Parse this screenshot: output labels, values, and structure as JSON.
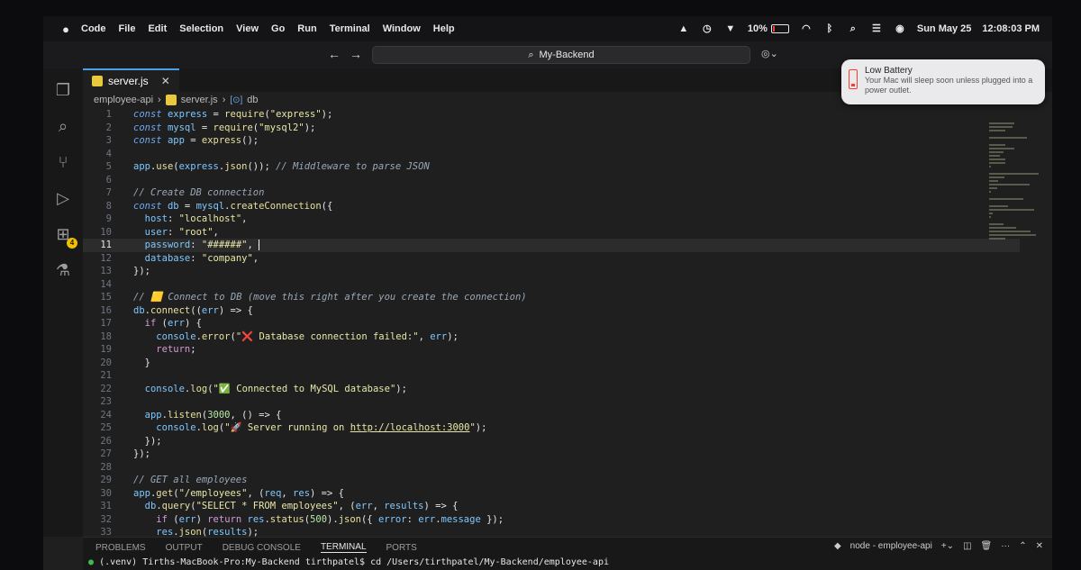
{
  "menubar": {
    "app_name": "Code",
    "menus": [
      "File",
      "Edit",
      "Selection",
      "View",
      "Go",
      "Run",
      "Terminal",
      "Window",
      "Help"
    ],
    "battery_percent": "10%",
    "battery_level": 0.1,
    "date": "Sun May 25",
    "time": "12:08:03 PM"
  },
  "titlebar": {
    "search_text": "My-Backend"
  },
  "activitybar": {
    "extensions_badge": "4"
  },
  "tab": {
    "filename": "server.js",
    "close": "✕"
  },
  "breadcrumb": {
    "folder": "employee-api",
    "file": "server.js",
    "symbol": "db"
  },
  "notification": {
    "title": "Low Battery",
    "body": "Your Mac will sleep soon unless plugged into a power outlet."
  },
  "editor": {
    "current_line": 11,
    "lines": [
      [
        [
          "kw",
          "const "
        ],
        [
          "var",
          "express"
        ],
        [
          "op",
          " = "
        ],
        [
          "fn",
          "require"
        ],
        [
          "op",
          "("
        ],
        [
          "str",
          "\"express\""
        ],
        [
          "op",
          ");"
        ]
      ],
      [
        [
          "kw",
          "const "
        ],
        [
          "var",
          "mysql"
        ],
        [
          "op",
          " = "
        ],
        [
          "fn",
          "require"
        ],
        [
          "op",
          "("
        ],
        [
          "str",
          "\"mysql2\""
        ],
        [
          "op",
          ");"
        ]
      ],
      [
        [
          "kw",
          "const "
        ],
        [
          "var",
          "app"
        ],
        [
          "op",
          " = "
        ],
        [
          "fn",
          "express"
        ],
        [
          "op",
          "();"
        ]
      ],
      [],
      [
        [
          "var",
          "app"
        ],
        [
          "op",
          "."
        ],
        [
          "fn",
          "use"
        ],
        [
          "op",
          "("
        ],
        [
          "var",
          "express"
        ],
        [
          "op",
          "."
        ],
        [
          "fn",
          "json"
        ],
        [
          "op",
          "()); "
        ],
        [
          "cm",
          "// Middleware to parse JSON"
        ]
      ],
      [],
      [
        [
          "cm",
          "// Create DB connection"
        ]
      ],
      [
        [
          "kw",
          "const "
        ],
        [
          "var",
          "db"
        ],
        [
          "op",
          " = "
        ],
        [
          "var",
          "mysql"
        ],
        [
          "op",
          "."
        ],
        [
          "fn",
          "createConnection"
        ],
        [
          "op",
          "({"
        ]
      ],
      [
        [
          "op",
          "  "
        ],
        [
          "var",
          "host"
        ],
        [
          "op",
          ": "
        ],
        [
          "str",
          "\"localhost\""
        ],
        [
          "op",
          ","
        ]
      ],
      [
        [
          "op",
          "  "
        ],
        [
          "var",
          "user"
        ],
        [
          "op",
          ": "
        ],
        [
          "str",
          "\"root\""
        ],
        [
          "op",
          ","
        ]
      ],
      [
        [
          "op",
          "  "
        ],
        [
          "var",
          "password"
        ],
        [
          "op",
          ": "
        ],
        [
          "str",
          "\"######\""
        ],
        [
          "op",
          ", "
        ]
      ],
      [
        [
          "op",
          "  "
        ],
        [
          "var",
          "database"
        ],
        [
          "op",
          ": "
        ],
        [
          "str",
          "\"company\""
        ],
        [
          "op",
          ","
        ]
      ],
      [
        [
          "op",
          "});"
        ]
      ],
      [],
      [
        [
          "cm",
          "// 🟨 Connect to DB (move this right after you create the connection)"
        ]
      ],
      [
        [
          "var",
          "db"
        ],
        [
          "op",
          "."
        ],
        [
          "fn",
          "connect"
        ],
        [
          "op",
          "(("
        ],
        [
          "var",
          "err"
        ],
        [
          "op",
          ") => {"
        ]
      ],
      [
        [
          "op",
          "  "
        ],
        [
          "ctl",
          "if"
        ],
        [
          "op",
          " ("
        ],
        [
          "var",
          "err"
        ],
        [
          "op",
          ") {"
        ]
      ],
      [
        [
          "op",
          "    "
        ],
        [
          "var",
          "console"
        ],
        [
          "op",
          "."
        ],
        [
          "fn",
          "error"
        ],
        [
          "op",
          "("
        ],
        [
          "str",
          "\"❌ Database connection failed:\""
        ],
        [
          "op",
          ", "
        ],
        [
          "var",
          "err"
        ],
        [
          "op",
          ");"
        ]
      ],
      [
        [
          "op",
          "    "
        ],
        [
          "ctl",
          "return"
        ],
        [
          "op",
          ";"
        ]
      ],
      [
        [
          "op",
          "  }"
        ]
      ],
      [],
      [
        [
          "op",
          "  "
        ],
        [
          "var",
          "console"
        ],
        [
          "op",
          "."
        ],
        [
          "fn",
          "log"
        ],
        [
          "op",
          "("
        ],
        [
          "str",
          "\"✅ Connected to MySQL database\""
        ],
        [
          "op",
          ");"
        ]
      ],
      [],
      [
        [
          "op",
          "  "
        ],
        [
          "var",
          "app"
        ],
        [
          "op",
          "."
        ],
        [
          "fn",
          "listen"
        ],
        [
          "op",
          "("
        ],
        [
          "num",
          "3000"
        ],
        [
          "op",
          ", () => {"
        ]
      ],
      [
        [
          "op",
          "    "
        ],
        [
          "var",
          "console"
        ],
        [
          "op",
          "."
        ],
        [
          "fn",
          "log"
        ],
        [
          "op",
          "("
        ],
        [
          "str",
          "\"🚀 Server running on "
        ],
        [
          "link",
          "http://localhost:3000"
        ],
        [
          "str",
          "\""
        ],
        [
          "op",
          ");"
        ]
      ],
      [
        [
          "op",
          "  });"
        ]
      ],
      [
        [
          "op",
          "});"
        ]
      ],
      [],
      [
        [
          "cm",
          "// GET all employees"
        ]
      ],
      [
        [
          "var",
          "app"
        ],
        [
          "op",
          "."
        ],
        [
          "fn",
          "get"
        ],
        [
          "op",
          "("
        ],
        [
          "str",
          "\"/employees\""
        ],
        [
          "op",
          ", ("
        ],
        [
          "var",
          "req"
        ],
        [
          "op",
          ", "
        ],
        [
          "var",
          "res"
        ],
        [
          "op",
          ") => {"
        ]
      ],
      [
        [
          "op",
          "  "
        ],
        [
          "var",
          "db"
        ],
        [
          "op",
          "."
        ],
        [
          "fn",
          "query"
        ],
        [
          "op",
          "("
        ],
        [
          "str",
          "\"SELECT * FROM employees\""
        ],
        [
          "op",
          ", ("
        ],
        [
          "var",
          "err"
        ],
        [
          "op",
          ", "
        ],
        [
          "var",
          "results"
        ],
        [
          "op",
          ") => {"
        ]
      ],
      [
        [
          "op",
          "    "
        ],
        [
          "ctl",
          "if"
        ],
        [
          "op",
          " ("
        ],
        [
          "var",
          "err"
        ],
        [
          "op",
          ") "
        ],
        [
          "ctl",
          "return "
        ],
        [
          "var",
          "res"
        ],
        [
          "op",
          "."
        ],
        [
          "fn",
          "status"
        ],
        [
          "op",
          "("
        ],
        [
          "num",
          "500"
        ],
        [
          "op",
          ")."
        ],
        [
          "fn",
          "json"
        ],
        [
          "op",
          "({ "
        ],
        [
          "var",
          "error"
        ],
        [
          "op",
          ": "
        ],
        [
          "var",
          "err"
        ],
        [
          "op",
          "."
        ],
        [
          "var",
          "message"
        ],
        [
          "op",
          " });"
        ]
      ],
      [
        [
          "op",
          "    "
        ],
        [
          "var",
          "res"
        ],
        [
          "op",
          "."
        ],
        [
          "fn",
          "json"
        ],
        [
          "op",
          "("
        ],
        [
          "var",
          "results"
        ],
        [
          "op",
          ");"
        ]
      ]
    ]
  },
  "panel": {
    "tabs": [
      "PROBLEMS",
      "OUTPUT",
      "DEBUG CONSOLE",
      "TERMINAL",
      "PORTS"
    ],
    "active_tab": "TERMINAL",
    "terminal_name": "node - employee-api",
    "terminal_prompt": "(.venv) Tirths-MacBook-Pro:My-Backend tirthpatel$ cd /Users/tirthpatel/My-Backend/employee-api"
  }
}
